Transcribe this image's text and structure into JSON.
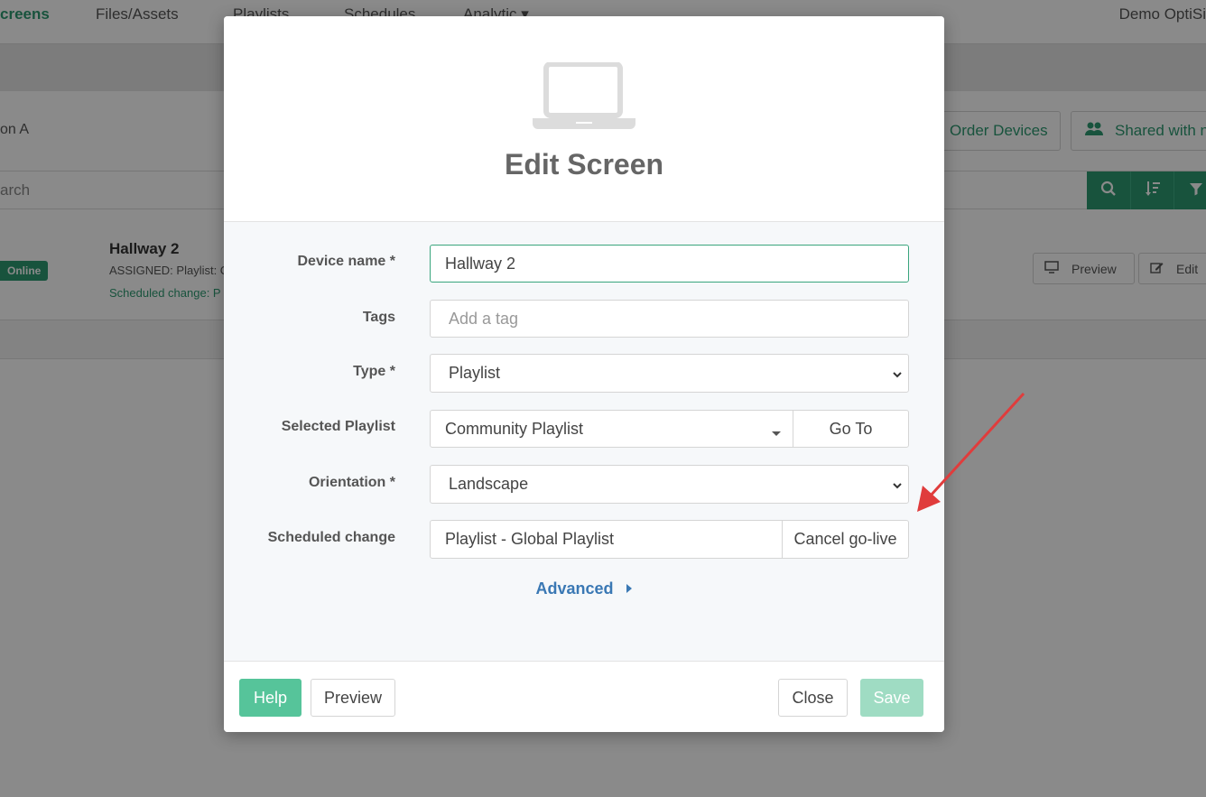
{
  "background": {
    "nav": {
      "items": [
        "creens",
        "Files/Assets",
        "Playlists",
        "Schedules",
        "Analytic"
      ],
      "user": "Demo OptiSi"
    },
    "location_label": "on A",
    "buttons": {
      "order_devices": "Order Devices",
      "shared_with": "Shared with n"
    },
    "search_placeholder": "arch",
    "device": {
      "status": "Online",
      "name": "Hallway 2",
      "assigned": "ASSIGNED: Playlist: C",
      "scheduled": "Scheduled change: P",
      "preview_label": "Preview",
      "edit_label": "Edit"
    }
  },
  "modal": {
    "icon": "laptop-icon",
    "title": "Edit Screen",
    "fields": {
      "device_name": {
        "label": "Device name *",
        "value": "Hallway 2"
      },
      "tags": {
        "label": "Tags",
        "placeholder": "Add a tag"
      },
      "type": {
        "label": "Type *",
        "value": "Playlist"
      },
      "selected_playlist": {
        "label": "Selected Playlist",
        "value": "Community Playlist",
        "button": "Go To"
      },
      "orientation": {
        "label": "Orientation *",
        "value": "Landscape"
      },
      "scheduled_change": {
        "label": "Scheduled change",
        "value": "Playlist - Global Playlist",
        "button": "Cancel go-live"
      }
    },
    "advanced_label": "Advanced",
    "footer": {
      "help": "Help",
      "preview": "Preview",
      "close": "Close",
      "save": "Save"
    }
  },
  "colors": {
    "accent": "#2e9a72",
    "help_button": "#56c49a",
    "save_disabled": "#9fdcc3",
    "link": "#3a78b4",
    "annotation_arrow": "#e03c3c"
  }
}
